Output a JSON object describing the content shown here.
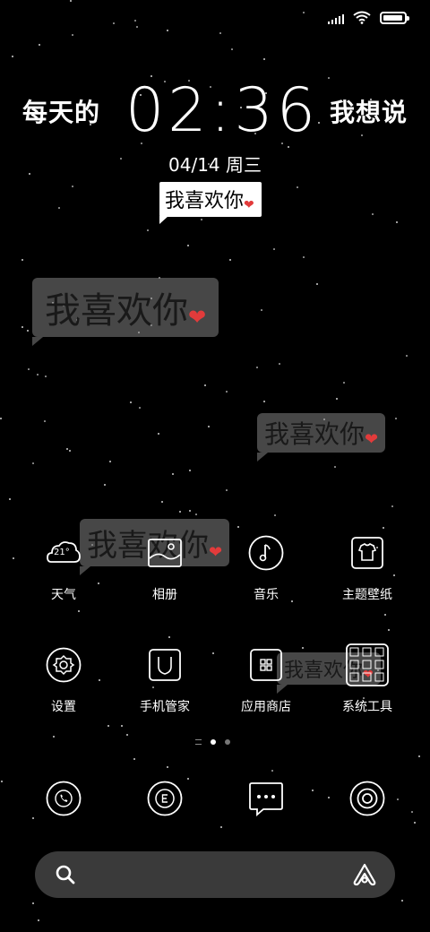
{
  "status_bar": {
    "signal_icon": "signal-icon",
    "wifi_icon": "wifi-icon",
    "battery_icon": "battery-icon",
    "battery_level": 0.95
  },
  "lockscreen": {
    "left_text": "每天的",
    "time": "02:36",
    "right_text": "我想说",
    "date": "04/14 周三",
    "bubble_text": "我喜欢你"
  },
  "floating_bubbles": [
    {
      "text": "我喜欢你"
    },
    {
      "text": "我喜欢你"
    },
    {
      "text": "我喜欢你"
    },
    {
      "text": "我喜欢你"
    }
  ],
  "apps": [
    {
      "label": "天气",
      "icon": "weather-icon",
      "temp": "21°"
    },
    {
      "label": "相册",
      "icon": "gallery-icon"
    },
    {
      "label": "音乐",
      "icon": "music-icon"
    },
    {
      "label": "主题壁纸",
      "icon": "themes-icon"
    },
    {
      "label": "设置",
      "icon": "settings-icon"
    },
    {
      "label": "手机管家",
      "icon": "security-icon"
    },
    {
      "label": "应用商店",
      "icon": "app-store-icon"
    },
    {
      "label": "系统工具",
      "icon": "tools-folder-icon"
    }
  ],
  "page_indicator": {
    "current": 2,
    "total": 3
  },
  "dock": [
    {
      "icon": "phone-icon"
    },
    {
      "icon": "browser-icon"
    },
    {
      "icon": "messages-icon"
    },
    {
      "icon": "camera-icon"
    }
  ],
  "search_bar": {
    "search_icon": "search-icon",
    "assistant_icon": "assistant-icon"
  }
}
